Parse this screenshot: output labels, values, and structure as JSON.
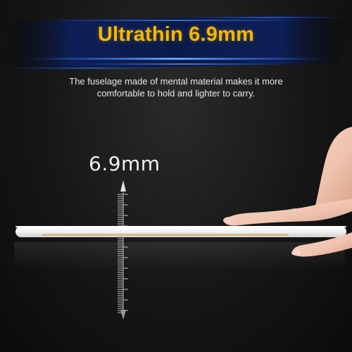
{
  "headline": "Ultrathin 6.9mm",
  "description": {
    "line1": "The fuselage made of mental material makes it more",
    "line2": "comfortable to hold and lighter to carry."
  },
  "measurement_label": "6.9mm",
  "colors": {
    "headline": "#f5b800",
    "banner_glow": "#2f6bff",
    "background": "#161616",
    "device_body": "#f4f4f4",
    "device_trim": "#d9b27a"
  }
}
